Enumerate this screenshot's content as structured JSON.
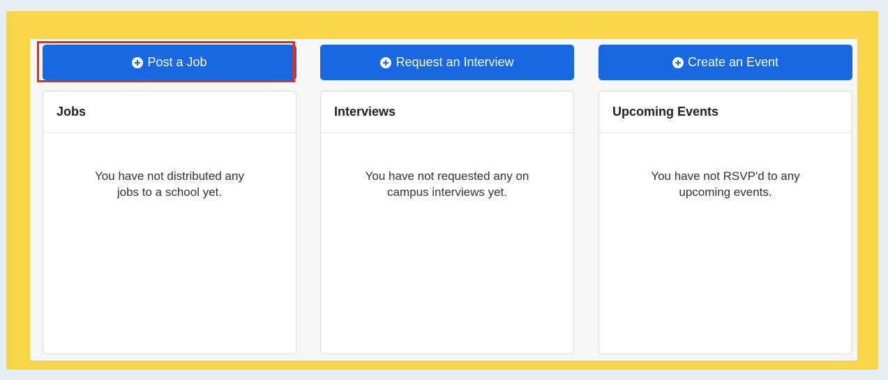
{
  "columns": [
    {
      "button_label": "Post a Job",
      "title": "Jobs",
      "empty_line1": "You have not distributed any",
      "empty_line2": "jobs to a school yet."
    },
    {
      "button_label": "Request an Interview",
      "title": "Interviews",
      "empty_line1": "You have not requested any on",
      "empty_line2": "campus interviews yet."
    },
    {
      "button_label": "Create an Event",
      "title": "Upcoming Events",
      "empty_line1": "You have not RSVP'd to any",
      "empty_line2": "upcoming events."
    }
  ],
  "colors": {
    "button": "#1a68e0",
    "highlight": "#ea2b17",
    "frame": "#f7d546"
  },
  "icons": {
    "button_icon": "plus-circle-icon"
  }
}
